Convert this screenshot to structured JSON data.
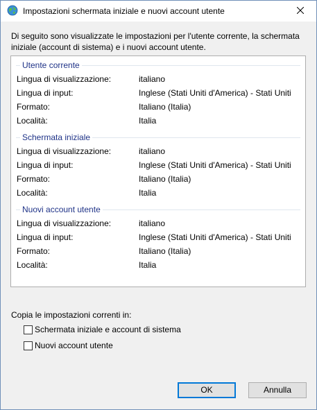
{
  "window": {
    "title": "Impostazioni schermata iniziale e nuovi account utente"
  },
  "intro_text": "Di seguito sono visualizzate le impostazioni per l'utente corrente, la schermata\niniziale (account di sistema) e i nuovi account utente.",
  "sections": [
    {
      "title": "Utente corrente",
      "rows": [
        {
          "label": "Lingua di visualizzazione:",
          "value": "italiano"
        },
        {
          "label": "Lingua di input:",
          "value": "Inglese (Stati Uniti d'America) - Stati Uniti"
        },
        {
          "label": "Formato:",
          "value": "Italiano (Italia)"
        },
        {
          "label": "Località:",
          "value": "Italia"
        }
      ]
    },
    {
      "title": "Schermata iniziale",
      "rows": [
        {
          "label": "Lingua di visualizzazione:",
          "value": "italiano"
        },
        {
          "label": "Lingua di input:",
          "value": "Inglese (Stati Uniti d'America) - Stati Uniti"
        },
        {
          "label": "Formato:",
          "value": "Italiano (Italia)"
        },
        {
          "label": "Località:",
          "value": "Italia"
        }
      ]
    },
    {
      "title": "Nuovi account utente",
      "rows": [
        {
          "label": "Lingua di visualizzazione:",
          "value": "italiano"
        },
        {
          "label": "Lingua di input:",
          "value": "Inglese (Stati Uniti d'America) - Stati Uniti"
        },
        {
          "label": "Formato:",
          "value": "Italiano (Italia)"
        },
        {
          "label": "Località:",
          "value": "Italia"
        }
      ]
    }
  ],
  "copy": {
    "label": "Copia le impostazioni correnti in:",
    "options": [
      {
        "label": "Schermata iniziale e account di sistema",
        "checked": false
      },
      {
        "label": "Nuovi account utente",
        "checked": false
      }
    ]
  },
  "buttons": {
    "ok": "OK",
    "cancel": "Annulla"
  },
  "icons": {
    "title_icon": "globe-icon",
    "close_icon": "close-icon"
  },
  "colors": {
    "section_header": "#1e3287",
    "default_button_border": "#0078d7"
  }
}
